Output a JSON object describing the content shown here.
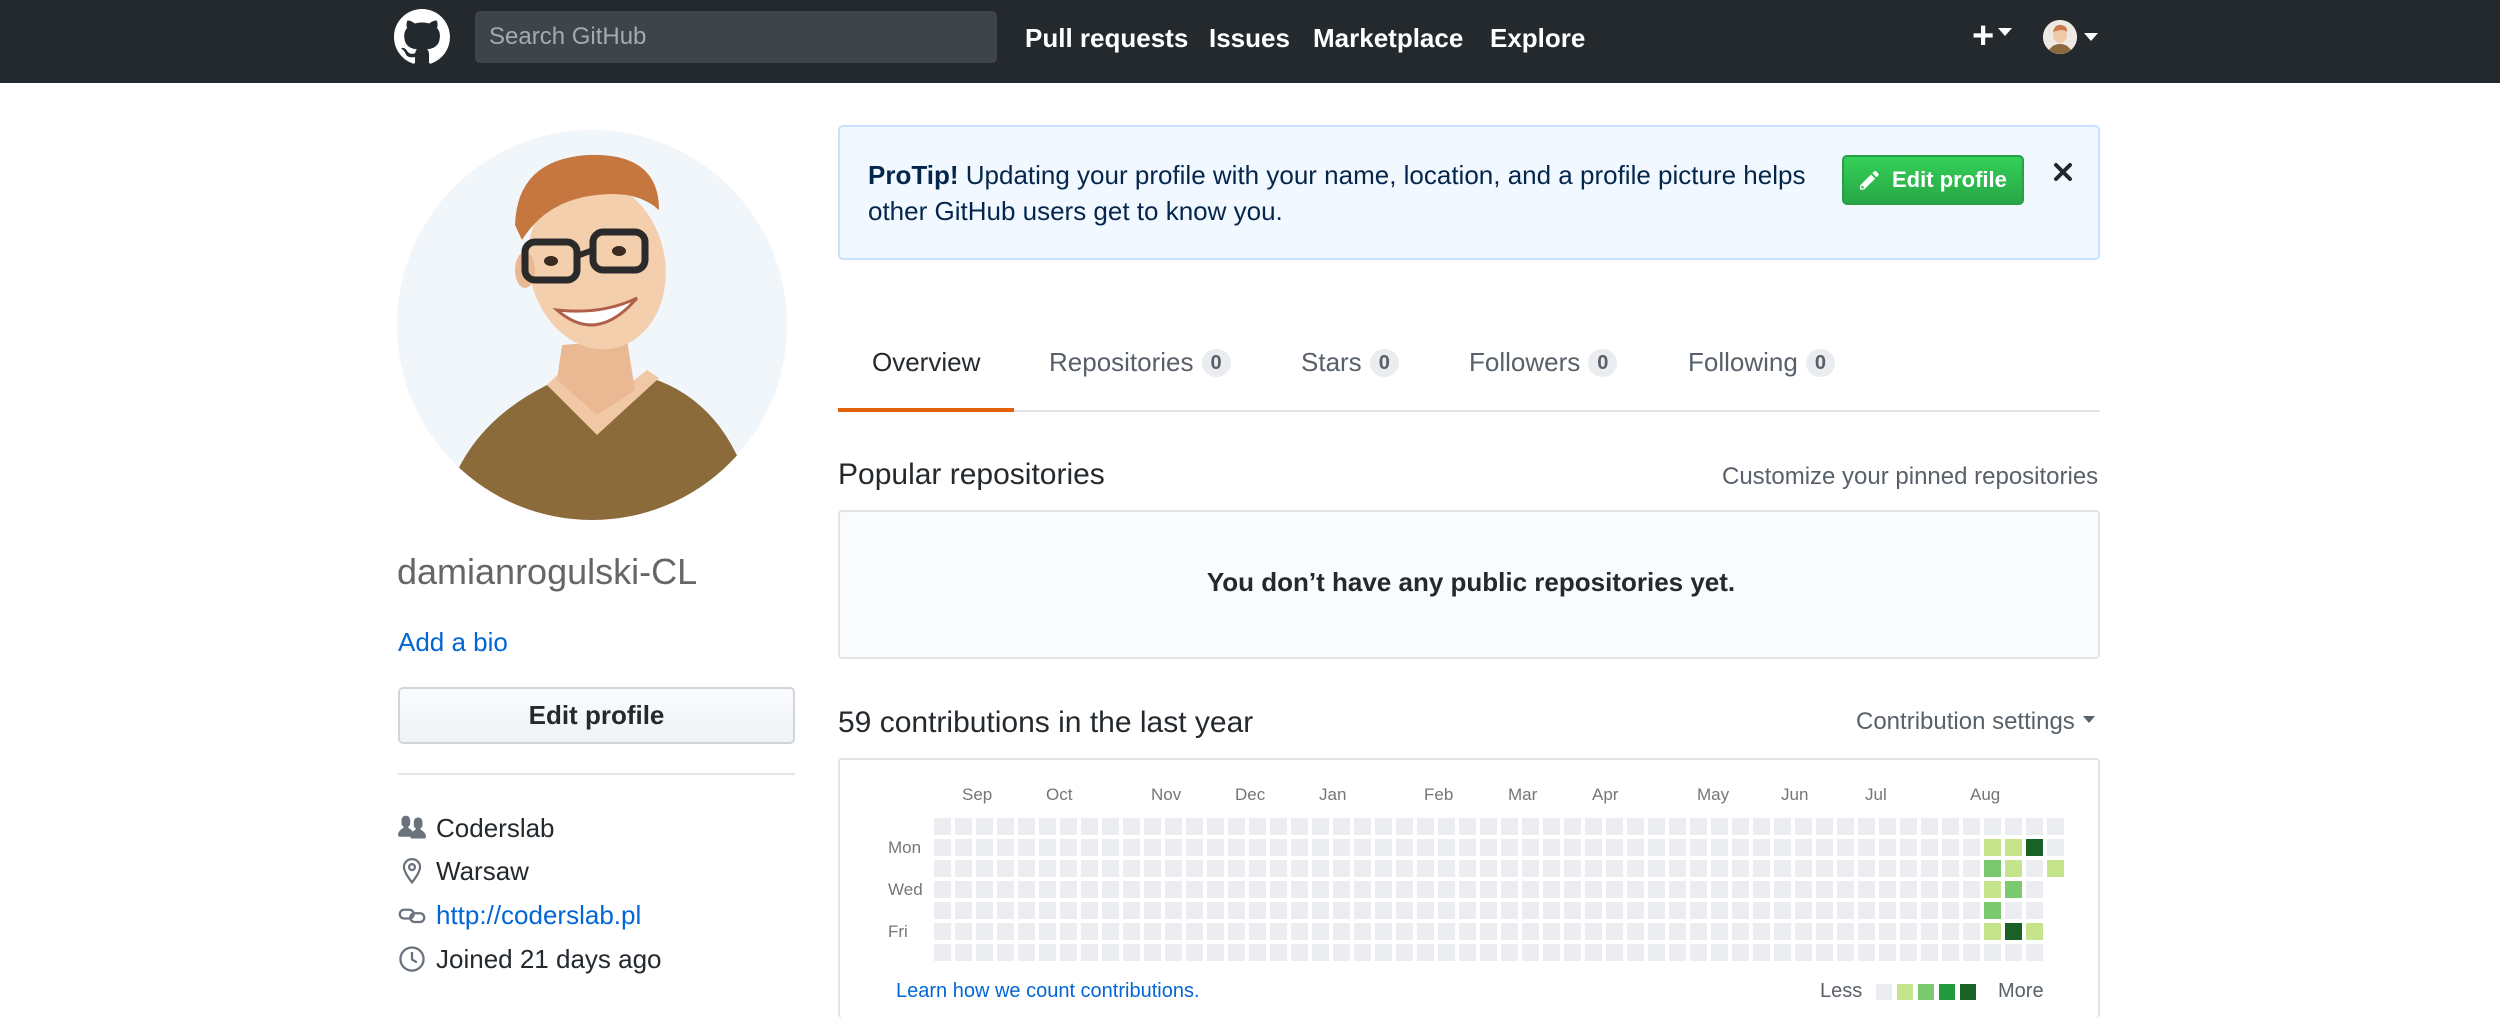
{
  "header": {
    "search_placeholder": "Search GitHub",
    "nav": [
      "Pull requests",
      "Issues",
      "Marketplace",
      "Explore"
    ],
    "plus_label": "+"
  },
  "profile": {
    "username": "damianrogulski-CL",
    "add_bio": "Add a bio",
    "edit_profile": "Edit profile",
    "details": [
      {
        "icon": "organization-icon",
        "text": "Coderslab",
        "link": false
      },
      {
        "icon": "location-icon",
        "text": "Warsaw",
        "link": false
      },
      {
        "icon": "link-icon",
        "text": "http://coderslab.pl",
        "link": true
      },
      {
        "icon": "clock-icon",
        "text": "Joined 21 days ago",
        "link": false
      }
    ]
  },
  "protip": {
    "label": "ProTip!",
    "text": " Updating your profile with your name, location, and a profile picture helps other GitHub users get to know you.",
    "button": "Edit profile"
  },
  "tabs": [
    {
      "label": "Overview",
      "count": null,
      "selected": true
    },
    {
      "label": "Repositories",
      "count": "0",
      "selected": false
    },
    {
      "label": "Stars",
      "count": "0",
      "selected": false
    },
    {
      "label": "Followers",
      "count": "0",
      "selected": false
    },
    {
      "label": "Following",
      "count": "0",
      "selected": false
    }
  ],
  "popular": {
    "title": "Popular repositories",
    "customize": "Customize your pinned repositories",
    "empty": "You don’t have any public repositories yet."
  },
  "contributions": {
    "title": "59 contributions in the last year",
    "settings": "Contribution settings",
    "learn": "Learn how we count contributions.",
    "less": "Less",
    "more": "More",
    "months": [
      "Sep",
      "Oct",
      "Nov",
      "Dec",
      "Jan",
      "Feb",
      "Mar",
      "Apr",
      "May",
      "Jun",
      "Jul",
      "Aug"
    ],
    "day_labels": [
      "Mon",
      "Wed",
      "Fri"
    ],
    "weeks": 53,
    "levels": [
      "#ebedf0",
      "#c6e48b",
      "#7bc96f",
      "#239a3b",
      "#196127"
    ],
    "active_cells": [
      {
        "week": 50,
        "day": 1,
        "level": 1
      },
      {
        "week": 51,
        "day": 1,
        "level": 1
      },
      {
        "week": 52,
        "day": 1,
        "level": 4
      },
      {
        "week": 50,
        "day": 2,
        "level": 2
      },
      {
        "week": 51,
        "day": 2,
        "level": 1
      },
      {
        "week": 53,
        "day": 2,
        "level": 1
      },
      {
        "week": 50,
        "day": 3,
        "level": 1
      },
      {
        "week": 51,
        "day": 3,
        "level": 2
      },
      {
        "week": 50,
        "day": 4,
        "level": 2
      },
      {
        "week": 50,
        "day": 5,
        "level": 1
      },
      {
        "week": 51,
        "day": 5,
        "level": 4
      },
      {
        "week": 52,
        "day": 5,
        "level": 1
      }
    ]
  }
}
